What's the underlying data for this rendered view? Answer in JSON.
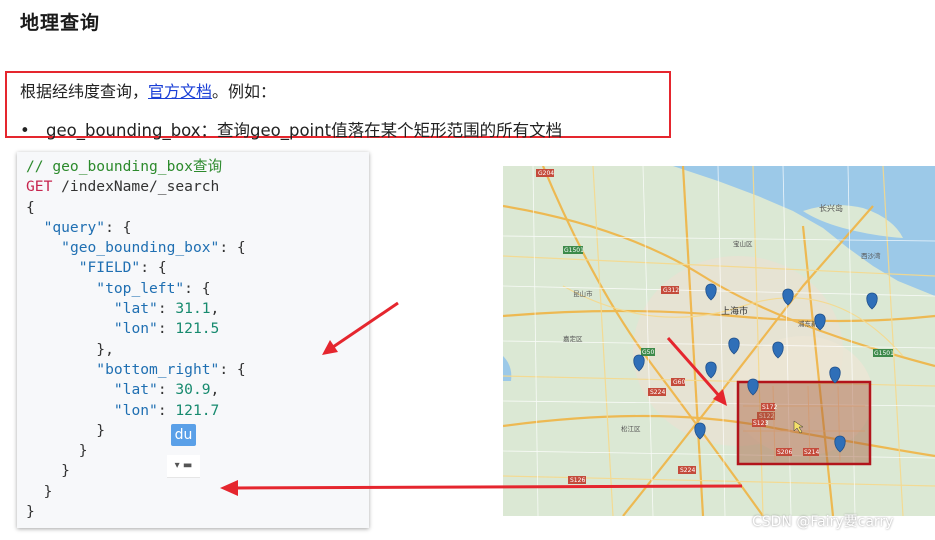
{
  "page": {
    "title": "地理查询",
    "intro_prefix": "根据经纬度查询，",
    "intro_link": "官方文档",
    "intro_suffix": "。例如：",
    "bullet_mark": "•",
    "bullet_text": "geo_bounding_box：查询geo_point值落在某个矩形范围的所有文档"
  },
  "code": {
    "comment": "// geo_bounding_box查询",
    "method": "GET",
    "path": " /indexName/_search",
    "brace_open": "{",
    "query_key": "\"query\"",
    "geo_key": "\"geo_bounding_box\"",
    "field_key": "\"FIELD\"",
    "top_left_key": "\"top_left\"",
    "lat_key": "\"lat\"",
    "lon_key": "\"lon\"",
    "lat1": "31.1",
    "lon1": "121.5",
    "bottom_right_key": "\"bottom_right\"",
    "lat2": "30.9",
    "lon2": "121.7",
    "brace_close": "}"
  },
  "overlay": {
    "du_label": "du",
    "du_control": "▾ ▬"
  },
  "map": {
    "city_label": "上海市",
    "labels": [
      "长兴岛",
      "崇明",
      "宝山区",
      "浦东新区",
      "闵行区",
      "松江区",
      "嘉定区",
      "青浦区"
    ],
    "route_labels": [
      "G204",
      "S221",
      "G1501",
      "G312",
      "S224",
      "G60",
      "S32",
      "S122",
      "S126",
      "G15",
      "S4",
      "S2"
    ]
  },
  "watermark": "CSDN @Fairy要carry",
  "colors": {
    "accent_red": "#e5262e",
    "link_blue": "#1a3fd6",
    "pin_blue": "#2f6fb8",
    "map_water": "#9cc9e8",
    "map_land": "#dbe8d4"
  }
}
